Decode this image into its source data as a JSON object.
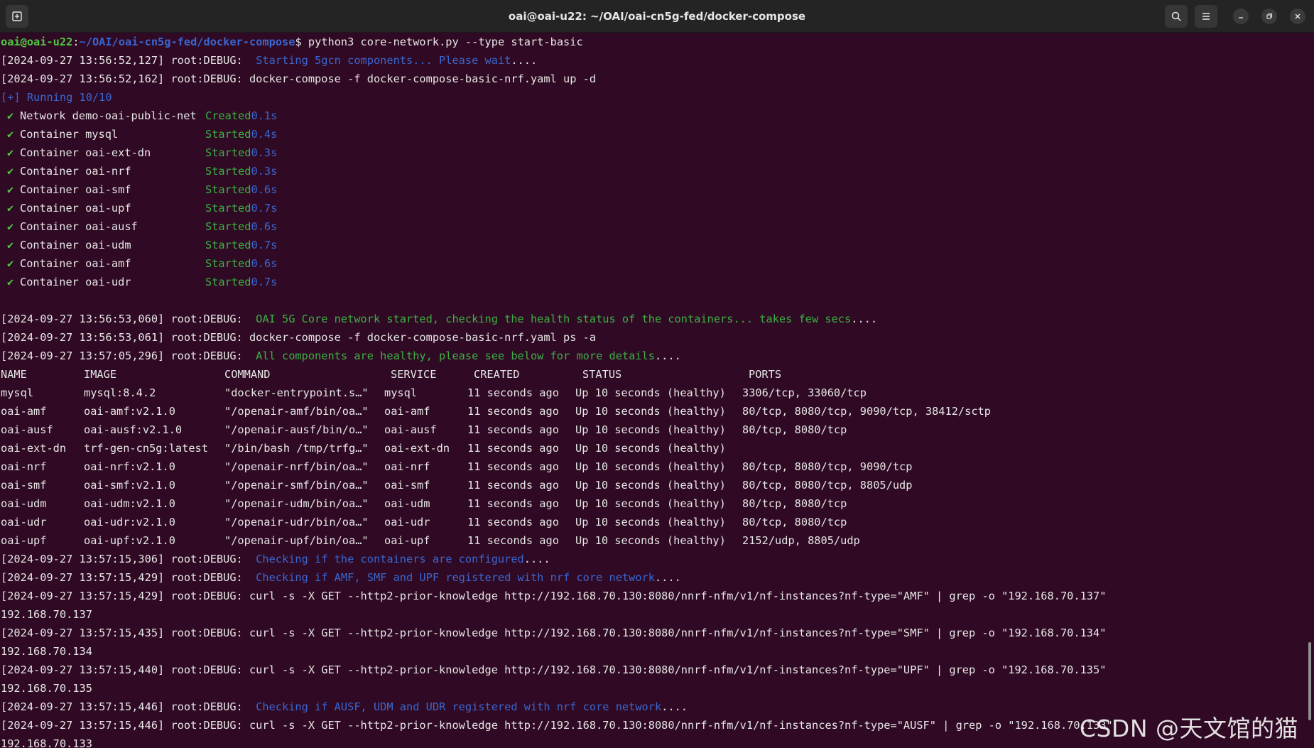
{
  "window": {
    "title": "oai@oai-u22: ~/OAI/oai-cn5g-fed/docker-compose"
  },
  "prompt": {
    "user": "oai@oai-u22",
    "sep": ":",
    "path": "~/OAI/oai-cn5g-fed/docker-compose",
    "dollar": "$ ",
    "command": "python3 core-network.py --type start-basic"
  },
  "log_top": [
    {
      "prefix": "[2024-09-27 13:56:52,127] root:DEBUG:  ",
      "msg": "Starting 5gcn components... Please wait",
      "tail": "....",
      "msg_color": "blue"
    },
    {
      "prefix": "[2024-09-27 13:56:52,162] root:DEBUG: docker-compose -f docker-compose-basic-nrf.yaml up -d",
      "msg": "",
      "tail": "",
      "msg_color": ""
    }
  ],
  "running": "[+] Running 10/10",
  "compose_items": [
    {
      "name": "Network demo-oai-public-net",
      "status": "Created",
      "time": "0.1s"
    },
    {
      "name": "Container mysql",
      "status": "Started",
      "time": "0.4s"
    },
    {
      "name": "Container oai-ext-dn",
      "status": "Started",
      "time": "0.3s"
    },
    {
      "name": "Container oai-nrf",
      "status": "Started",
      "time": "0.3s"
    },
    {
      "name": "Container oai-smf",
      "status": "Started",
      "time": "0.6s"
    },
    {
      "name": "Container oai-upf",
      "status": "Started",
      "time": "0.7s"
    },
    {
      "name": "Container oai-ausf",
      "status": "Started",
      "time": "0.6s"
    },
    {
      "name": "Container oai-udm",
      "status": "Started",
      "time": "0.7s"
    },
    {
      "name": "Container oai-amf",
      "status": "Started",
      "time": "0.6s"
    },
    {
      "name": "Container oai-udr",
      "status": "Started",
      "time": "0.7s"
    }
  ],
  "log_mid": [
    {
      "prefix": "[2024-09-27 13:56:53,060] root:DEBUG:  ",
      "msg": "OAI 5G Core network started, checking the health status of the containers... takes few secs",
      "tail": "....",
      "msg_color": "green"
    },
    {
      "prefix": "[2024-09-27 13:56:53,061] root:DEBUG: docker-compose -f docker-compose-basic-nrf.yaml ps -a",
      "msg": "",
      "tail": "",
      "msg_color": ""
    },
    {
      "prefix": "[2024-09-27 13:57:05,296] root:DEBUG:  ",
      "msg": "All components are healthy, please see below for more details",
      "tail": "....",
      "msg_color": "green"
    }
  ],
  "ps_table": {
    "headers": [
      "NAME",
      "IMAGE",
      "COMMAND",
      "SERVICE",
      "CREATED",
      "STATUS",
      "PORTS"
    ],
    "rows": [
      [
        "mysql",
        "mysql:8.4.2",
        "\"docker-entrypoint.s…\"",
        "mysql",
        "11 seconds ago",
        "Up 10 seconds (healthy)",
        "3306/tcp, 33060/tcp"
      ],
      [
        "oai-amf",
        "oai-amf:v2.1.0",
        "\"/openair-amf/bin/oa…\"",
        "oai-amf",
        "11 seconds ago",
        "Up 10 seconds (healthy)",
        "80/tcp, 8080/tcp, 9090/tcp, 38412/sctp"
      ],
      [
        "oai-ausf",
        "oai-ausf:v2.1.0",
        "\"/openair-ausf/bin/o…\"",
        "oai-ausf",
        "11 seconds ago",
        "Up 10 seconds (healthy)",
        "80/tcp, 8080/tcp"
      ],
      [
        "oai-ext-dn",
        "trf-gen-cn5g:latest",
        "\"/bin/bash /tmp/trfg…\"",
        "oai-ext-dn",
        "11 seconds ago",
        "Up 10 seconds (healthy)",
        ""
      ],
      [
        "oai-nrf",
        "oai-nrf:v2.1.0",
        "\"/openair-nrf/bin/oa…\"",
        "oai-nrf",
        "11 seconds ago",
        "Up 10 seconds (healthy)",
        "80/tcp, 8080/tcp, 9090/tcp"
      ],
      [
        "oai-smf",
        "oai-smf:v2.1.0",
        "\"/openair-smf/bin/oa…\"",
        "oai-smf",
        "11 seconds ago",
        "Up 10 seconds (healthy)",
        "80/tcp, 8080/tcp, 8805/udp"
      ],
      [
        "oai-udm",
        "oai-udm:v2.1.0",
        "\"/openair-udm/bin/oa…\"",
        "oai-udm",
        "11 seconds ago",
        "Up 10 seconds (healthy)",
        "80/tcp, 8080/tcp"
      ],
      [
        "oai-udr",
        "oai-udr:v2.1.0",
        "\"/openair-udr/bin/oa…\"",
        "oai-udr",
        "11 seconds ago",
        "Up 10 seconds (healthy)",
        "80/tcp, 8080/tcp"
      ],
      [
        "oai-upf",
        "oai-upf:v2.1.0",
        "\"/openair-upf/bin/oa…\"",
        "oai-upf",
        "11 seconds ago",
        "Up 10 seconds (healthy)",
        "2152/udp, 8805/udp"
      ]
    ]
  },
  "log_bottom": [
    {
      "prefix": "[2024-09-27 13:57:15,306] root:DEBUG:  ",
      "msg": "Checking if the containers are configured",
      "tail": "....",
      "msg_color": "blue"
    },
    {
      "prefix": "[2024-09-27 13:57:15,429] root:DEBUG:  ",
      "msg": "Checking if AMF, SMF and UPF registered with nrf core network",
      "tail": "....",
      "msg_color": "blue"
    },
    {
      "prefix": "[2024-09-27 13:57:15,429] root:DEBUG: curl -s -X GET --http2-prior-knowledge http://192.168.70.130:8080/nnrf-nfm/v1/nf-instances?nf-type=\"AMF\" | grep -o \"192.168.70.137\"",
      "msg": "",
      "tail": "",
      "msg_color": ""
    },
    {
      "prefix": "192.168.70.137",
      "msg": "",
      "tail": "",
      "msg_color": ""
    },
    {
      "prefix": "[2024-09-27 13:57:15,435] root:DEBUG: curl -s -X GET --http2-prior-knowledge http://192.168.70.130:8080/nnrf-nfm/v1/nf-instances?nf-type=\"SMF\" | grep -o \"192.168.70.134\"",
      "msg": "",
      "tail": "",
      "msg_color": ""
    },
    {
      "prefix": "192.168.70.134",
      "msg": "",
      "tail": "",
      "msg_color": ""
    },
    {
      "prefix": "[2024-09-27 13:57:15,440] root:DEBUG: curl -s -X GET --http2-prior-knowledge http://192.168.70.130:8080/nnrf-nfm/v1/nf-instances?nf-type=\"UPF\" | grep -o \"192.168.70.135\"",
      "msg": "",
      "tail": "",
      "msg_color": ""
    },
    {
      "prefix": "192.168.70.135",
      "msg": "",
      "tail": "",
      "msg_color": ""
    },
    {
      "prefix": "[2024-09-27 13:57:15,446] root:DEBUG:  ",
      "msg": "Checking if AUSF, UDM and UDR registered with nrf core network",
      "tail": "....",
      "msg_color": "blue"
    },
    {
      "prefix": "[2024-09-27 13:57:15,446] root:DEBUG: curl -s -X GET --http2-prior-knowledge http://192.168.70.130:8080/nnrf-nfm/v1/nf-instances?nf-type=\"AUSF\" | grep -o \"192.168.70.133\"",
      "msg": "",
      "tail": "",
      "msg_color": ""
    },
    {
      "prefix": "192.168.70.133",
      "msg": "",
      "tail": "",
      "msg_color": ""
    }
  ],
  "watermark": "CSDN @天文馆的猫",
  "colors": {
    "background": "#300a24",
    "titlebar": "#242424",
    "blue_text": "#3a66d0",
    "green_text": "#3cb043"
  }
}
